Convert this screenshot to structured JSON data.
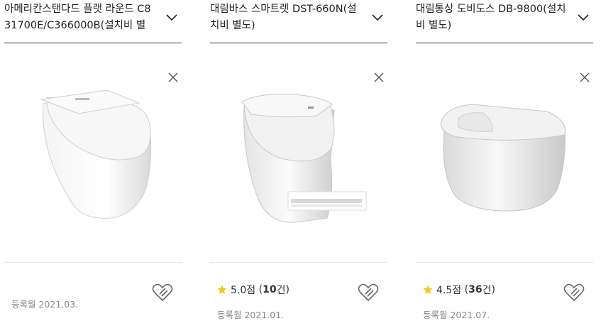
{
  "products": [
    {
      "title": "아메리칸스탠다드 플랫 라운드 C8 31700E/C366000B(설치비 별",
      "rating_score": "",
      "rating_count": "",
      "registered_date": "등록월 2021.03."
    },
    {
      "title": "대림바스 스마트렛 DST-660N(설치비 별도)",
      "rating_score": "5.0점",
      "rating_count": "10",
      "rating_count_unit": "건",
      "registered_date": "등록월 2021.01."
    },
    {
      "title": "대림통상 도비도스 DB-9800(설치비 별도)",
      "rating_score": "4.5점",
      "rating_count": "36",
      "rating_count_unit": "건",
      "registered_date": "등록월 2021.07."
    }
  ],
  "colors": {
    "star": "#f5c518",
    "divider": "#e6e6e6",
    "header_line": "#333333",
    "muted_text": "#888888"
  },
  "icons": {
    "expand": "chevron-down-icon",
    "remove": "close-icon",
    "favorite": "heart-add-icon",
    "rating": "star-icon"
  }
}
